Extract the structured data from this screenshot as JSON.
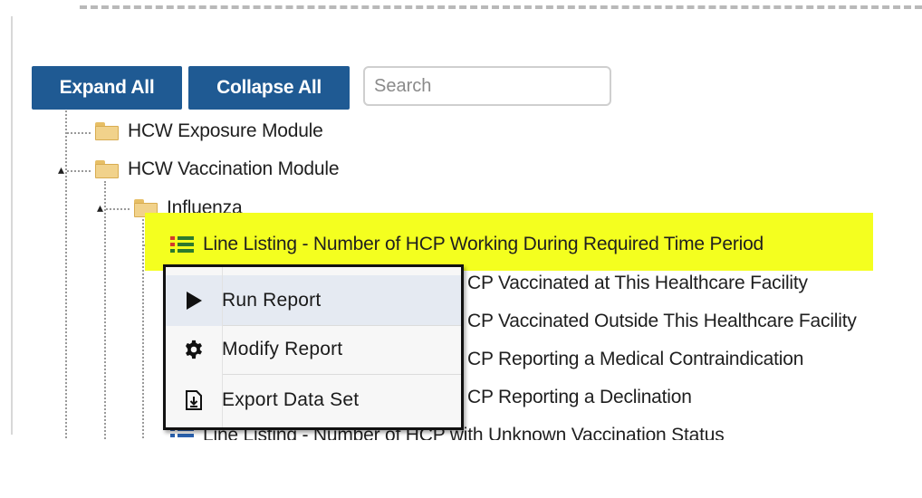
{
  "toolbar": {
    "expand_label": "Expand All",
    "collapse_label": "Collapse All",
    "search_placeholder": "Search"
  },
  "tree": {
    "exposure_module": "HCW Exposure Module",
    "vaccination_module": "HCW Vaccination Module",
    "influenza": "Influenza",
    "reports": [
      "Line Listing - Number of HCP Working During Required Time Period",
      "CP Vaccinated at This Healthcare Facility",
      "CP Vaccinated Outside This Healthcare Facility",
      "CP Reporting a Medical Contraindication",
      "CP Reporting a Declination",
      "Line Listing - Number of HCP with Unknown Vaccination Status"
    ]
  },
  "context_menu": {
    "run_label": "Run Report",
    "modify_label": "Modify Report",
    "export_label": "Export Data Set"
  },
  "colors": {
    "button_bg": "#1f5a93",
    "highlight": "#f4ff1f",
    "menu_border": "#111111"
  },
  "icons": {
    "run": "play-icon",
    "modify": "gear-icon",
    "export": "export-file-icon",
    "folder": "folder-icon",
    "report": "report-list-icon"
  }
}
